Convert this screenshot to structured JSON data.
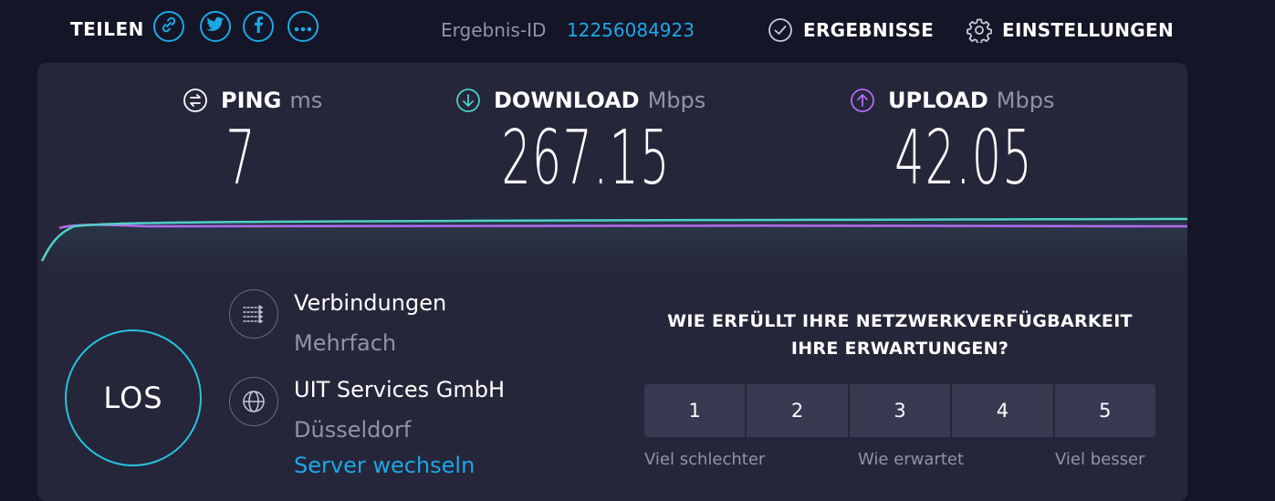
{
  "share": {
    "label": "TEILEN",
    "buttons": [
      {
        "icon": "link-icon"
      },
      {
        "icon": "twitter-icon"
      },
      {
        "icon": "facebook-icon"
      },
      {
        "icon": "more-icon"
      }
    ]
  },
  "result": {
    "label": "Ergebnis-ID",
    "id": "12256084923"
  },
  "nav": {
    "results": "ERGEBNISSE",
    "settings": "EINSTELLUNGEN"
  },
  "metrics": {
    "ping": {
      "label": "PING",
      "unit": "ms",
      "value": "7",
      "icon": "ping-icon",
      "color": "#ffffff"
    },
    "download": {
      "label": "DOWNLOAD",
      "unit": "Mbps",
      "value": "267.15",
      "icon": "download-arrow-icon",
      "color": "#4fd1c5"
    },
    "upload": {
      "label": "UPLOAD",
      "unit": "Mbps",
      "value": "42.05",
      "icon": "upload-arrow-icon",
      "color": "#b36bf0"
    }
  },
  "go_button": "LOS",
  "connections": {
    "title": "Verbindungen",
    "value": "Mehrfach",
    "icon": "connections-icon"
  },
  "server": {
    "provider": "UIT Services GmbH",
    "location": "Düsseldorf",
    "change_link": "Server wechseln",
    "icon": "globe-icon"
  },
  "survey": {
    "question_line1": "WIE ERFÜLLT IHRE NETZWERKVERFÜGBARKEIT",
    "question_line2": "IHRE ERWARTUNGEN?",
    "ratings": [
      "1",
      "2",
      "3",
      "4",
      "5"
    ],
    "label_low": "Viel schlechter",
    "label_mid": "Wie erwartet",
    "label_high": "Viel besser"
  },
  "colors": {
    "accent": "#1ca8e5",
    "download": "#4fd1c5",
    "upload": "#b36bf0",
    "background": "#141526",
    "panel": "#25263a"
  }
}
